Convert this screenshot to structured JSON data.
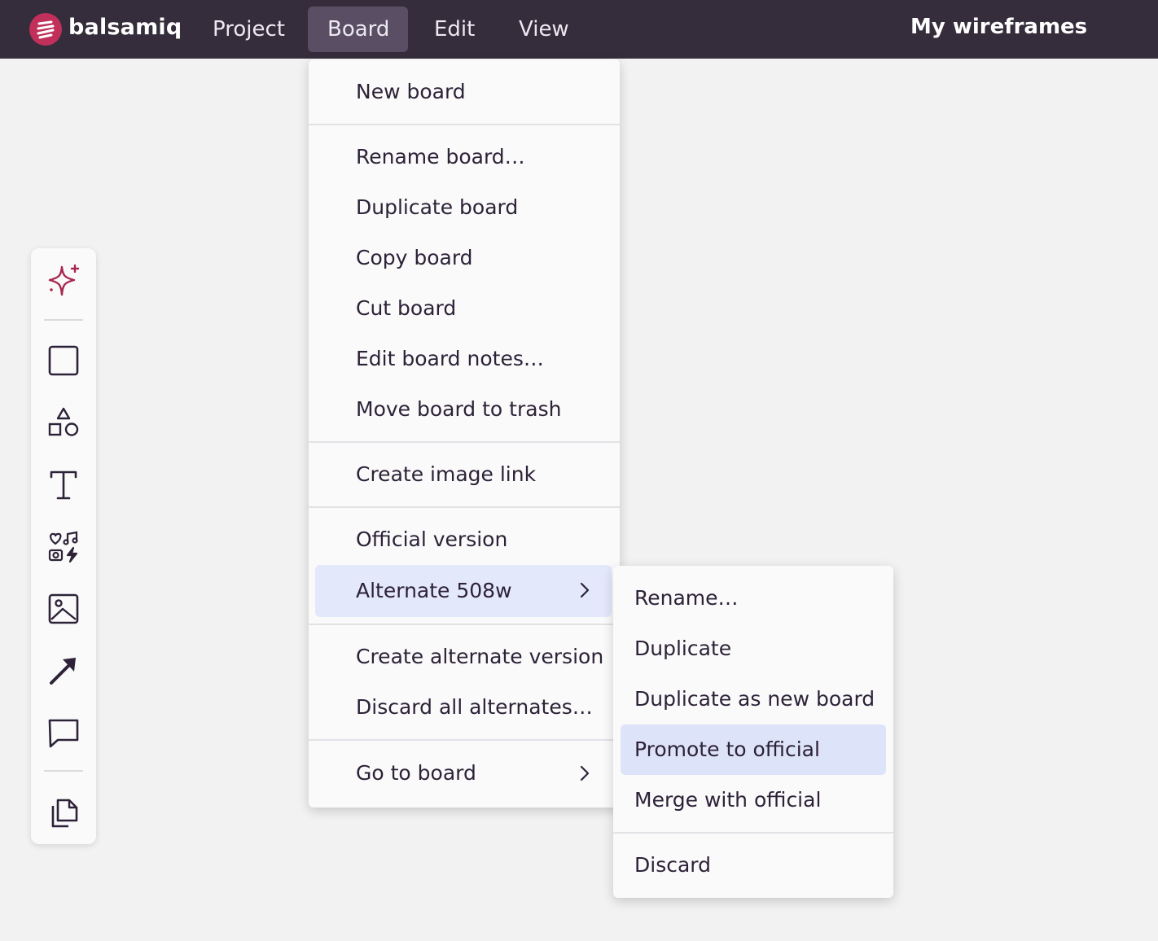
{
  "app": {
    "brand": "balsamiq",
    "logo_icon": "balsamiq-logo-icon",
    "accent": "#c0305a"
  },
  "menubar": {
    "items": [
      {
        "label": "Project"
      },
      {
        "label": "Board",
        "active": true
      },
      {
        "label": "Edit"
      },
      {
        "label": "View"
      }
    ],
    "right_link": "My wireframes",
    "background": "#352d3b",
    "active_background": "#594e64"
  },
  "toolbar": {
    "tools": [
      {
        "icon": "ai-sparkle-icon"
      },
      {
        "icon": "rectangle-icon"
      },
      {
        "icon": "shapes-icon"
      },
      {
        "icon": "text-icon"
      },
      {
        "icon": "icons-library-icon"
      },
      {
        "icon": "image-icon"
      },
      {
        "icon": "arrow-icon"
      },
      {
        "icon": "comment-icon"
      },
      {
        "icon": "copy-pages-icon"
      }
    ]
  },
  "board_menu": {
    "items": {
      "new_board": "New board",
      "rename_board": "Rename board…",
      "duplicate_board": "Duplicate board",
      "copy_board": "Copy board",
      "cut_board": "Cut board",
      "edit_board_notes": "Edit board notes…",
      "move_board_to_trash": "Move board to trash",
      "create_image_link": "Create image link",
      "official_version": "Official version",
      "alternate": "Alternate 508w",
      "create_alternate_version": "Create alternate version",
      "discard_all_alternates": "Discard all alternates…",
      "go_to_board": "Go to board"
    },
    "highlight_color": "#e4e8fb"
  },
  "alternate_submenu": {
    "items": {
      "rename": "Rename…",
      "duplicate": "Duplicate",
      "duplicate_as_new_board": "Duplicate as new board",
      "promote_to_official": "Promote to official",
      "merge_with_official": "Merge with official",
      "discard": "Discard"
    },
    "highlight_color": "#dde3f9"
  }
}
